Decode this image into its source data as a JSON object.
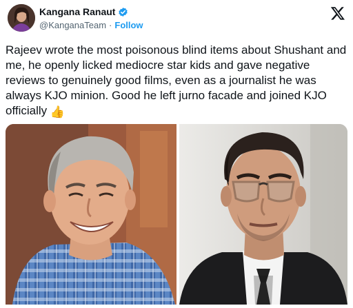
{
  "author": {
    "name": "Kangana Ranaut",
    "handle": "@KanganaTeam",
    "separator": "·",
    "follow_label": "Follow",
    "verified_icon": "verified-badge-icon",
    "brand_color": "#1d9bf0"
  },
  "platform_logo": "x-logo-icon",
  "tweet": {
    "text": "Rajeev wrote the most poisonous blind items about Shushant and me, he openly licked mediocre star kids and gave negative reviews to genuinely good films, even as a journalist he was always KJO minion. Good he left jurno facade and joined KJO officially",
    "emoji": "👍"
  },
  "media": [
    {
      "name": "photo-left",
      "icon": "man-blue-checkered-shirt-photo"
    },
    {
      "name": "photo-right",
      "icon": "man-glasses-dark-suit-photo"
    }
  ]
}
